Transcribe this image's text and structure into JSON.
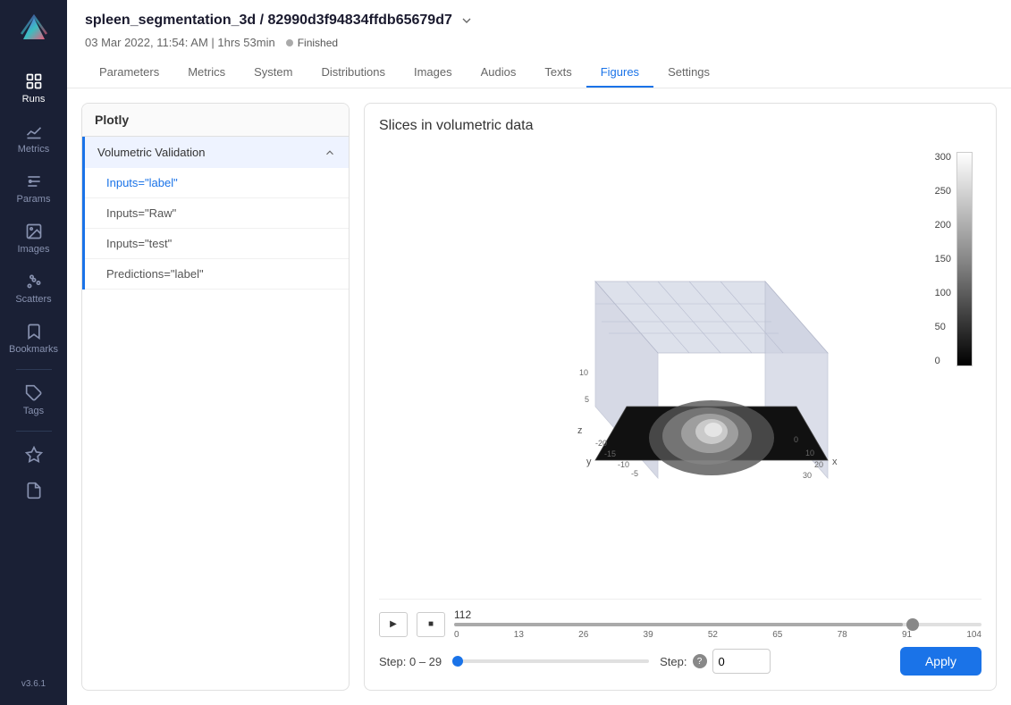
{
  "app": {
    "version": "v3.6.1"
  },
  "run": {
    "name": "spleen_segmentation_3d",
    "id": "82990d3f94834ffdb65679d7",
    "datetime": "03 Mar 2022, 11:54: AM | 1hrs 53min",
    "status": "Finished"
  },
  "tabs": [
    {
      "label": "Parameters",
      "active": false
    },
    {
      "label": "Metrics",
      "active": false
    },
    {
      "label": "System",
      "active": false
    },
    {
      "label": "Distributions",
      "active": false
    },
    {
      "label": "Images",
      "active": false
    },
    {
      "label": "Audios",
      "active": false
    },
    {
      "label": "Texts",
      "active": false
    },
    {
      "label": "Figures",
      "active": true
    },
    {
      "label": "Settings",
      "active": false
    }
  ],
  "sidebar": {
    "items": [
      {
        "id": "runs",
        "label": "Runs"
      },
      {
        "id": "metrics",
        "label": "Metrics"
      },
      {
        "id": "params",
        "label": "Params"
      },
      {
        "id": "images",
        "label": "Images"
      },
      {
        "id": "scatters",
        "label": "Scatters"
      },
      {
        "id": "bookmarks",
        "label": "Bookmarks"
      },
      {
        "id": "tags",
        "label": "Tags"
      }
    ]
  },
  "left_panel": {
    "header": "Plotly",
    "tree": {
      "section": "Volumetric Validation",
      "items": [
        {
          "label": "Inputs=\"label\"",
          "active": true
        },
        {
          "label": "Inputs=\"Raw\"",
          "active": false
        },
        {
          "label": "Inputs=\"test\"",
          "active": false
        },
        {
          "label": "Predictions=\"label\"",
          "active": false
        }
      ]
    }
  },
  "chart": {
    "title": "Slices in volumetric data",
    "colorbar_labels": [
      "300",
      "250",
      "200",
      "150",
      "100",
      "50",
      "0"
    ],
    "slider": {
      "value": "112",
      "ticks": [
        "0",
        "13",
        "26",
        "39",
        "52",
        "65",
        "78",
        "91",
        "104"
      ]
    }
  },
  "step_controls": {
    "range_label": "Step:",
    "range_value": "0 – 29",
    "input_label": "Step:",
    "input_value": "0",
    "apply_label": "Apply"
  }
}
